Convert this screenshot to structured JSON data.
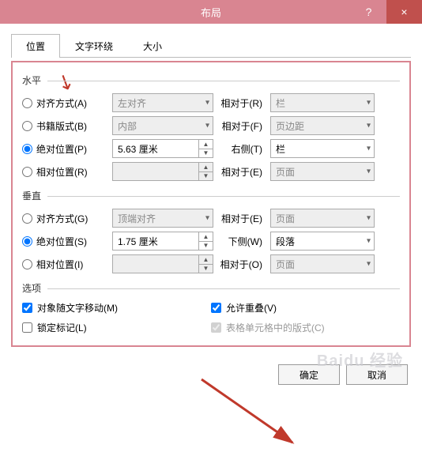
{
  "titlebar": {
    "title": "布局",
    "help": "?",
    "close": "×"
  },
  "tabs": {
    "t0": "位置",
    "t1": "文字环绕",
    "t2": "大小"
  },
  "sections": {
    "horizontal": "水平",
    "vertical": "垂直",
    "options": "选项"
  },
  "horizontal": {
    "alignRadio": "对齐方式(A)",
    "alignValue": "左对齐",
    "alignRelLabel": "相对于(R)",
    "alignRelValue": "栏",
    "bookRadio": "书籍版式(B)",
    "bookValue": "内部",
    "bookRelLabel": "相对于(F)",
    "bookRelValue": "页边距",
    "absRadio": "绝对位置(P)",
    "absValue": "5.63 厘米",
    "absRelLabel": "右侧(T)",
    "absRelValue": "栏",
    "relRadio": "相对位置(R)",
    "relValue": "",
    "relRelLabel": "相对于(E)",
    "relRelValue": "页面"
  },
  "vertical": {
    "alignRadio": "对齐方式(G)",
    "alignValue": "顶端对齐",
    "alignRelLabel": "相对于(E)",
    "alignRelValue": "页面",
    "absRadio": "绝对位置(S)",
    "absValue": "1.75 厘米",
    "absRelLabel": "下侧(W)",
    "absRelValue": "段落",
    "relRadio": "相对位置(I)",
    "relValue": "",
    "relRelLabel": "相对于(O)",
    "relRelValue": "页面"
  },
  "options": {
    "moveWithText": "对象随文字移动(M)",
    "lockAnchor": "锁定标记(L)",
    "allowOverlap": "允许重叠(V)",
    "tableCellLayout": "表格单元格中的版式(C)"
  },
  "buttons": {
    "ok": "确定",
    "cancel": "取消"
  },
  "watermark": "Baidu 经验"
}
